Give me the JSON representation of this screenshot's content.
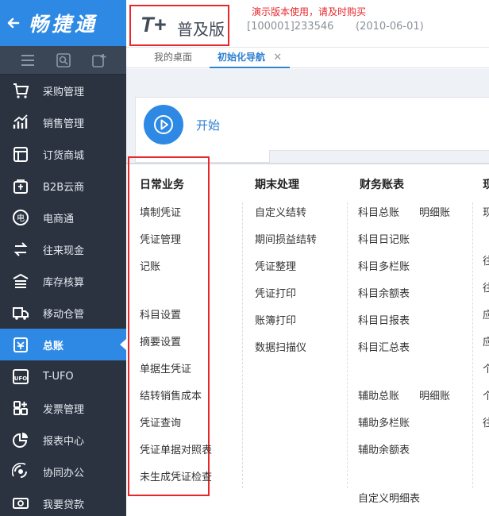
{
  "brand": {
    "title": "畅捷通"
  },
  "sidebar": {
    "items": [
      {
        "label": "采购管理",
        "icon": "cart-icon"
      },
      {
        "label": "销售管理",
        "icon": "trend-icon"
      },
      {
        "label": "订货商城",
        "icon": "store-icon"
      },
      {
        "label": "B2B云商",
        "icon": "bag-icon"
      },
      {
        "label": "电商通",
        "icon": "ecommerce-icon"
      },
      {
        "label": "往来现金",
        "icon": "exchange-icon"
      },
      {
        "label": "库存核算",
        "icon": "warehouse-icon"
      },
      {
        "label": "移动仓管",
        "icon": "truck-icon"
      },
      {
        "label": "总账",
        "icon": "ledger-icon",
        "active": true
      },
      {
        "label": "T-UFO",
        "icon": "ufo-icon"
      },
      {
        "label": "发票管理",
        "icon": "invoice-icon"
      },
      {
        "label": "报表中心",
        "icon": "pie-icon"
      },
      {
        "label": "协同办公",
        "icon": "collab-icon"
      },
      {
        "label": "我要贷款",
        "icon": "money-icon"
      }
    ]
  },
  "header": {
    "logo_t": "T+",
    "logo_edition": "普及版",
    "demo_note": "演示版本使用，请及时购买",
    "account": "[100001]233546",
    "date": "(2010-06-01)"
  },
  "tabs": [
    {
      "label": "我的桌面"
    },
    {
      "label": "初始化导航",
      "close": "✕"
    }
  ],
  "start": {
    "label": "开始"
  },
  "columns": {
    "daily": {
      "title": "日常业务",
      "links": [
        "填制凭证",
        "凭证管理",
        "记账",
        "科目设置",
        "摘要设置",
        "单据生凭证",
        "结转销售成本",
        "凭证查询",
        "凭证单据对照表",
        "未生成凭证检查"
      ]
    },
    "period_end": {
      "title": "期末处理",
      "links": [
        "自定义结转",
        "期间损益结转",
        "凭证整理",
        "凭证打印",
        "账簿打印",
        "数据扫描仪"
      ]
    },
    "finance": {
      "title": "财务账表",
      "links": [
        "科目总账",
        "明细账",
        "科目日记账",
        "科目多栏账",
        "科目余额表",
        "科目日报表",
        "科目汇总表",
        "辅助总账",
        "明细账",
        "辅助多栏账",
        "辅助余额表",
        "自定义明细表"
      ]
    },
    "fourth": {
      "title": "现",
      "links": [
        "现",
        "往",
        "往",
        "应",
        "应",
        "个",
        "个",
        "往"
      ]
    }
  }
}
